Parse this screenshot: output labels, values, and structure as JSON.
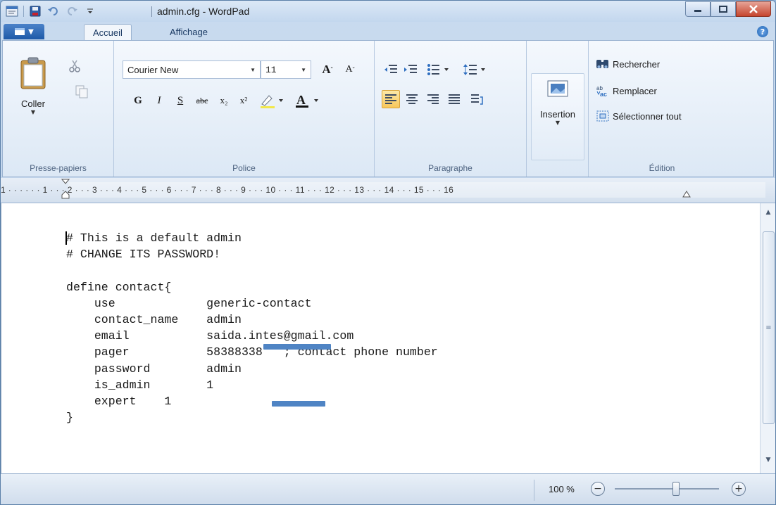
{
  "window": {
    "title": "admin.cfg - WordPad"
  },
  "tabs": [
    {
      "label": "Accueil",
      "active": true
    },
    {
      "label": "Affichage",
      "active": false
    }
  ],
  "clipboard": {
    "paste_label": "Coller",
    "group_label": "Presse-papiers"
  },
  "font": {
    "family": "Courier New",
    "size": "11",
    "group_label": "Police",
    "bold": "G",
    "italic": "I",
    "underline": "S",
    "strike": "abc",
    "subscript": "x₂",
    "superscript": "x²"
  },
  "paragraph": {
    "group_label": "Paragraphe",
    "active_alignment": "left"
  },
  "insert": {
    "label": "Insertion"
  },
  "editing": {
    "group_label": "Édition",
    "find": "Rechercher",
    "replace": "Remplacer",
    "select_all": "Sélectionner tout"
  },
  "ruler": {
    "scale": "1 · · ·  · · · 1 · · · 2 · · · 3 · · · 4 · · · 5 · · · 6 · · · 7 · · · 8 · · · 9 · · · 10 · · · 11 · · · 12 · · · 13 · · · 14 · · · 15 · · · 16"
  },
  "document": {
    "lines": [
      "# This is a default admin",
      "# CHANGE ITS PASSWORD!",
      "",
      "define contact{",
      "    use             generic-contact",
      "    contact_name    admin",
      "    email           saida.intes@gmail.com",
      "    pager           58388338   ; contact phone number",
      "    password        admin",
      "    is_admin        1",
      "    expert    1",
      "}"
    ]
  },
  "status": {
    "zoom": "100 %",
    "zoom_value_percent": 100
  },
  "colors": {
    "redaction": "#4f84c4",
    "active_button": "#f7c75a"
  }
}
